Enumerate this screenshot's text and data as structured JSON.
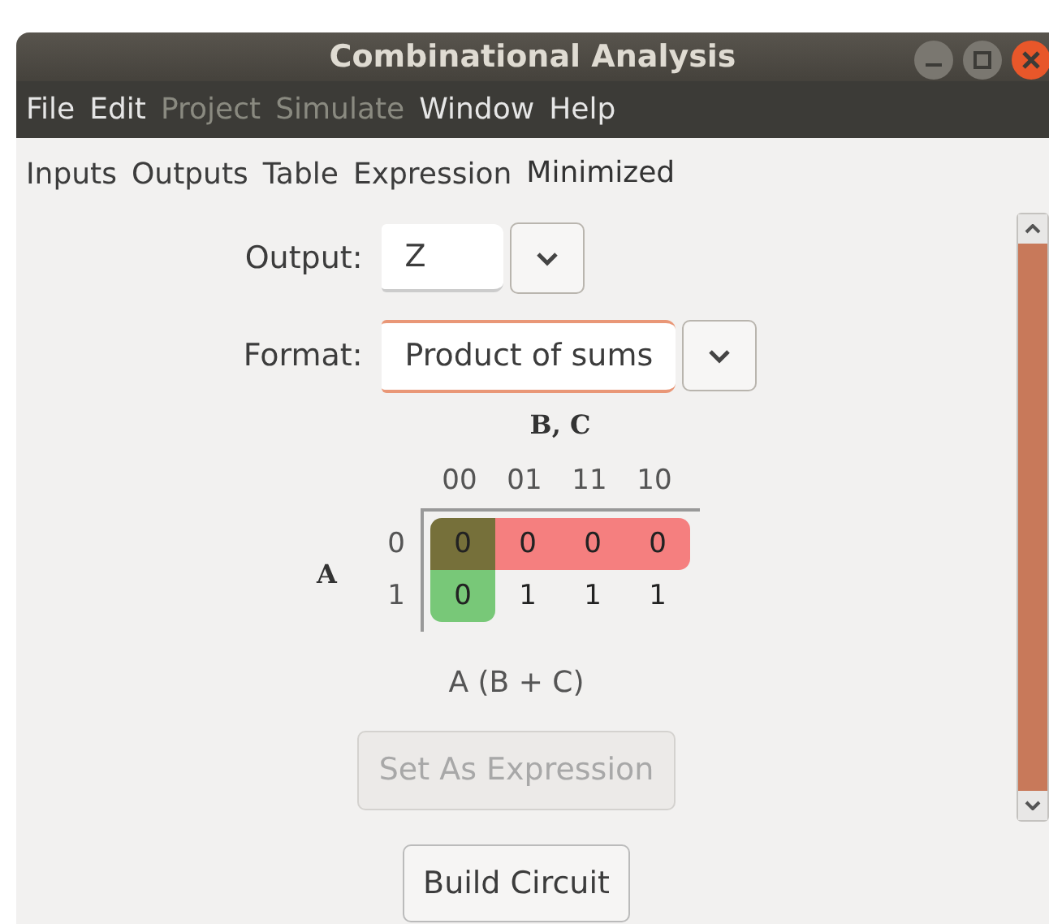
{
  "window": {
    "title": "Combinational Analysis"
  },
  "menu": [
    {
      "label": "File",
      "disabled": false
    },
    {
      "label": "Edit",
      "disabled": false
    },
    {
      "label": "Project",
      "disabled": true
    },
    {
      "label": "Simulate",
      "disabled": true
    },
    {
      "label": "Window",
      "disabled": false
    },
    {
      "label": "Help",
      "disabled": false
    }
  ],
  "tabs": [
    {
      "label": "Inputs",
      "selected": false
    },
    {
      "label": "Outputs",
      "selected": false
    },
    {
      "label": "Table",
      "selected": false
    },
    {
      "label": "Expression",
      "selected": false
    },
    {
      "label": "Minimized",
      "selected": true
    }
  ],
  "output": {
    "label": "Output:",
    "value": "Z"
  },
  "format": {
    "label": "Format:",
    "value": "Product of sums"
  },
  "kmap": {
    "row_variable": "A",
    "column_variables": "B, C",
    "column_headers": [
      "00",
      "01",
      "11",
      "10"
    ],
    "rows": [
      {
        "header": "0",
        "cells": [
          {
            "value": "0",
            "color": "#76703a"
          },
          {
            "value": "0",
            "color": "#f57f7f"
          },
          {
            "value": "0",
            "color": "#f57f7f"
          },
          {
            "value": "0",
            "color": "#f57f7f"
          }
        ]
      },
      {
        "header": "1",
        "cells": [
          {
            "value": "0",
            "color": "#78c878"
          },
          {
            "value": "1"
          },
          {
            "value": "1"
          },
          {
            "value": "1"
          }
        ]
      }
    ]
  },
  "expression": "A (B + C)",
  "buttons": [
    {
      "label": "Set As Expression",
      "disabled": true
    },
    {
      "label": "Build Circuit",
      "disabled": false
    }
  ]
}
